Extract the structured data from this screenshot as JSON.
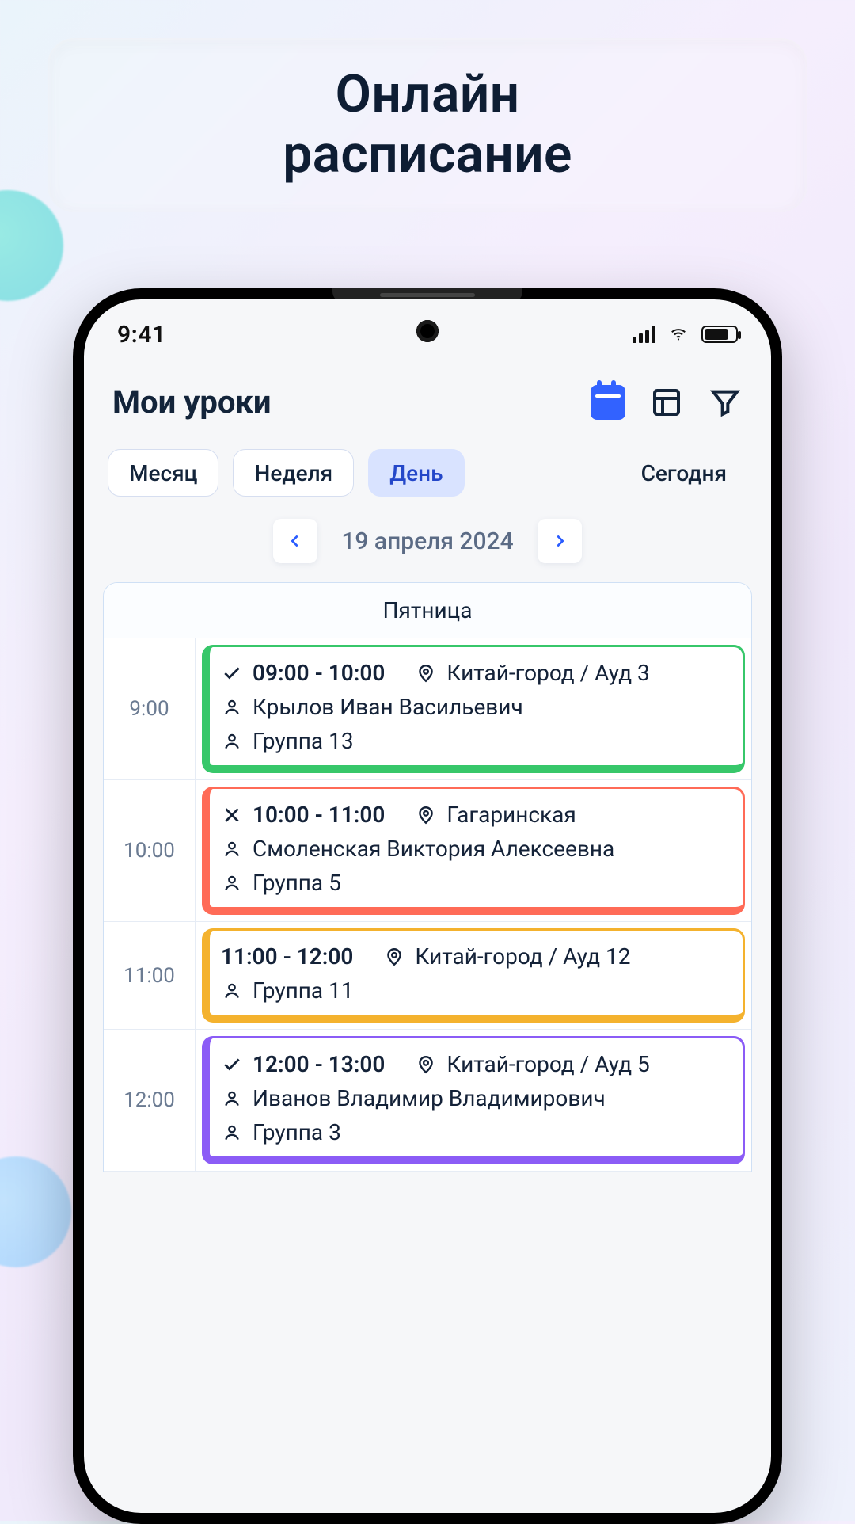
{
  "promo": {
    "line1": "Онлайн",
    "line2": "расписание"
  },
  "status": {
    "time": "9:41"
  },
  "header": {
    "title": "Мои уроки"
  },
  "views": {
    "month": "Месяц",
    "week": "Неделя",
    "day": "День",
    "today": "Сегодня"
  },
  "dateNav": {
    "label": "19 апреля 2024"
  },
  "dayName": "Пятница",
  "hours": [
    "9:00",
    "10:00",
    "11:00",
    "12:00"
  ],
  "lessons": [
    {
      "status": "check",
      "time": "09:00 - 10:00",
      "location": "Китай-город / Ауд 3",
      "teacher": "Крылов Иван Васильевич",
      "group": "Группа 13",
      "color": "green"
    },
    {
      "status": "cross",
      "time": "10:00 - 11:00",
      "location": "Гагаринская",
      "teacher": "Смоленская Виктория Алексеевна",
      "group": "Группа 5",
      "color": "red"
    },
    {
      "status": "",
      "time": "11:00 - 12:00",
      "location": "Китай-город / Ауд 12",
      "teacher": "",
      "group": "Группа 11",
      "color": "yellow"
    },
    {
      "status": "check",
      "time": "12:00 - 13:00",
      "location": "Китай-город / Ауд 5",
      "teacher": "Иванов Владимир Владимирович",
      "group": "Группа 3",
      "color": "purple"
    }
  ]
}
